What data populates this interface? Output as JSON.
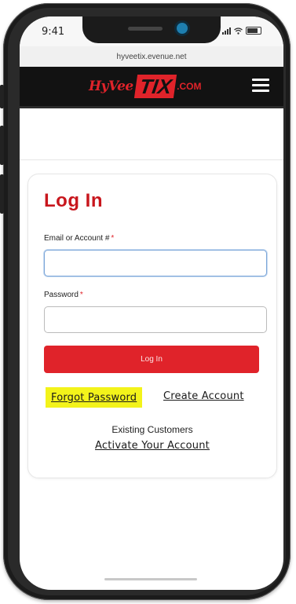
{
  "status_bar": {
    "time": "9:41"
  },
  "browser": {
    "url": "hyveetix.evenue.net"
  },
  "header": {
    "logo": {
      "part1": "HyVee",
      "part2": "TIX",
      "part3": ".COM"
    },
    "menu_icon": "hamburger-menu-icon"
  },
  "login": {
    "title": "Log In",
    "email_label": "Email or Account #",
    "email_required": "*",
    "email_value": "",
    "password_label": "Password",
    "password_required": "*",
    "password_value": "",
    "submit_label": "Log In",
    "forgot_password": "Forgot Password",
    "create_account": "Create Account",
    "existing_customers": "Existing Customers",
    "activate_account": "Activate Your Account"
  },
  "colors": {
    "brand_red": "#e0232a",
    "title_red": "#c8161d",
    "header_bg": "#121212",
    "highlight_yellow": "#f3f31a"
  }
}
